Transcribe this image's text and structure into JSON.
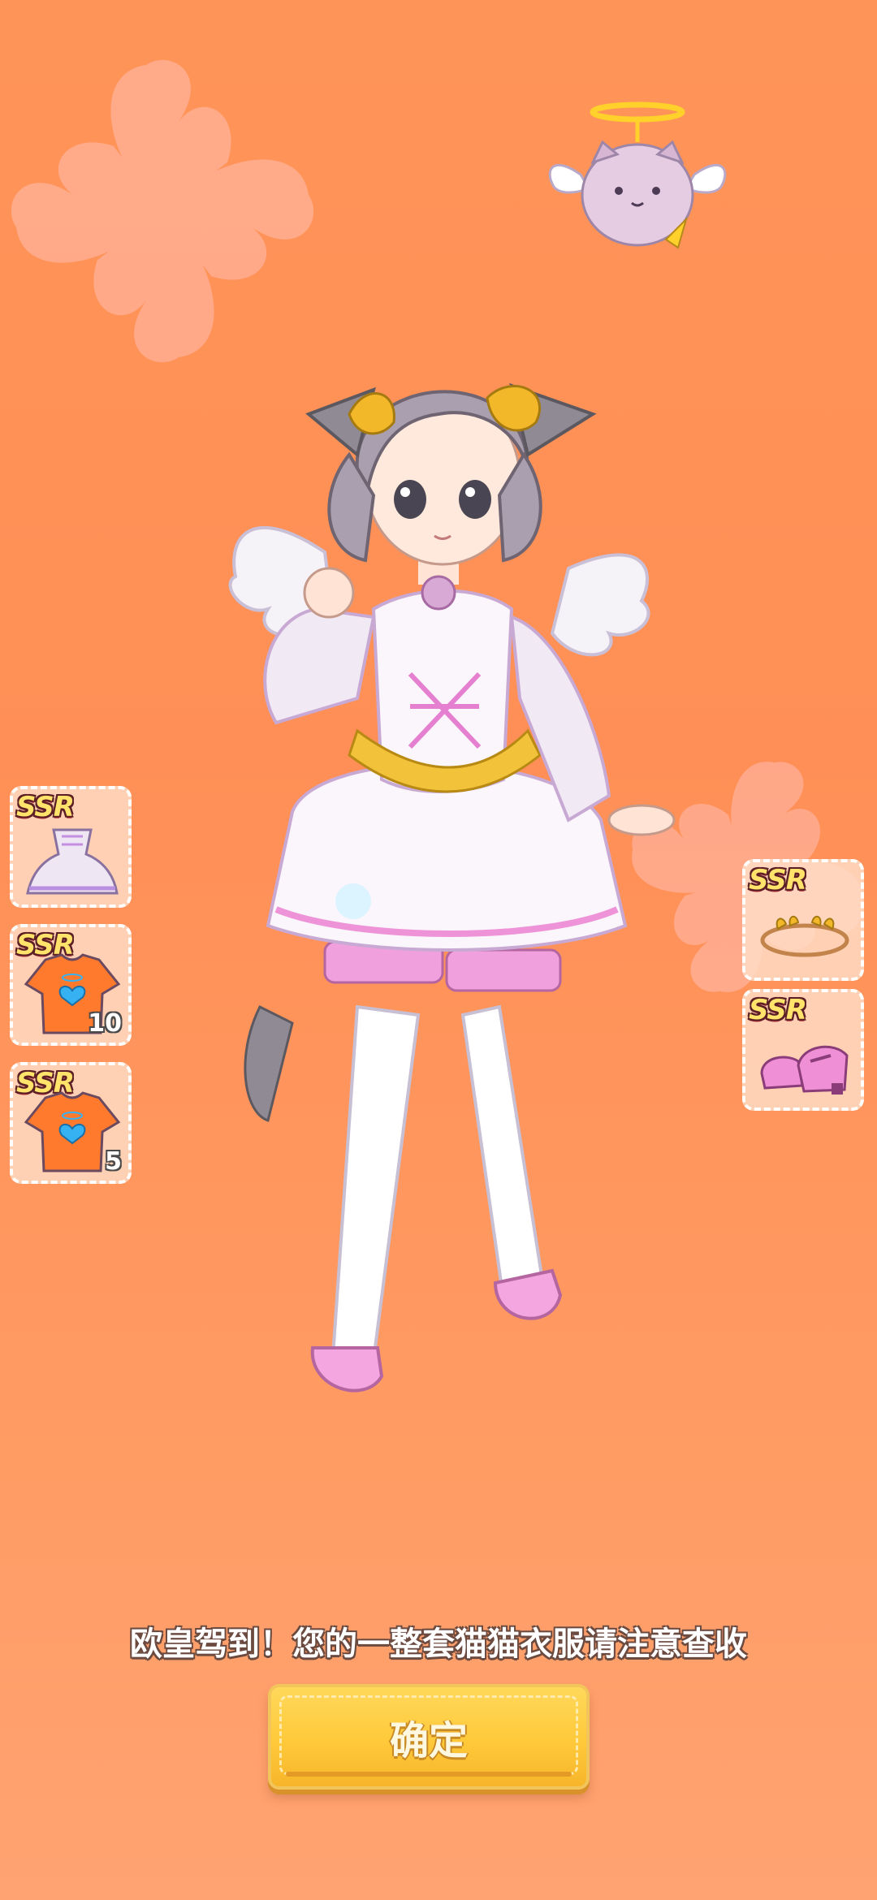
{
  "rewards_left": [
    {
      "rarity": "SSR",
      "item": "angel-dress-icon",
      "count": ""
    },
    {
      "rarity": "SSR",
      "item": "angel-shirt-icon",
      "count": "10"
    },
    {
      "rarity": "SSR",
      "item": "angel-shirt-icon",
      "count": "5"
    }
  ],
  "rewards_right": [
    {
      "rarity": "SSR",
      "item": "laurel-headband-icon",
      "count": ""
    },
    {
      "rarity": "SSR",
      "item": "pink-shoes-icon",
      "count": ""
    }
  ],
  "message": "欧皇驾到！您的一整套猫猫衣服请注意查收",
  "confirm_label": "确定",
  "colors": {
    "background": "#ff9458",
    "button": "#ffc93a",
    "rarity_text": "#ffe36a"
  }
}
